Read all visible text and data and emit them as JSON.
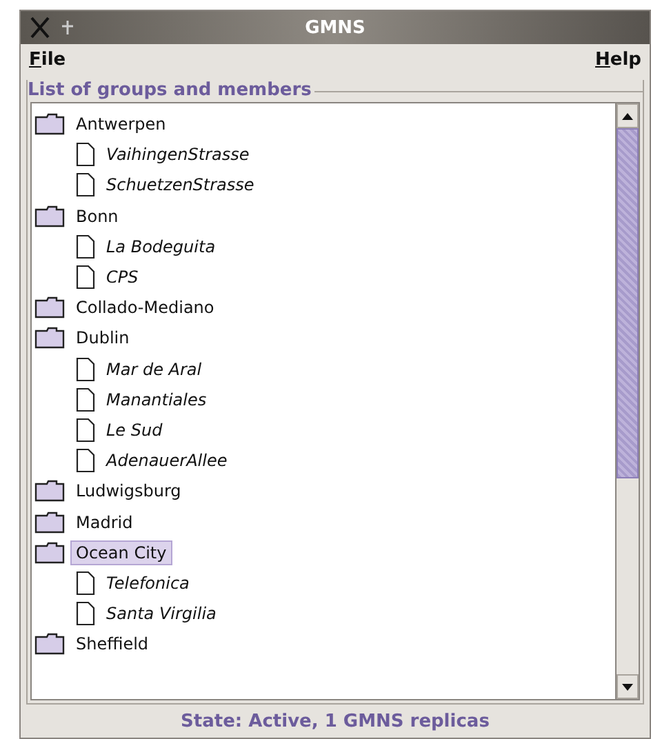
{
  "window": {
    "title": "GMNS"
  },
  "menu": [
    {
      "label": "File"
    },
    {
      "label": "Help"
    }
  ],
  "group_box": {
    "title": "List of groups and members"
  },
  "tree": [
    {
      "label": "Antwerpen",
      "selected": false,
      "children": [
        {
          "label": "VaihingenStrasse"
        },
        {
          "label": "SchuetzenStrasse"
        }
      ]
    },
    {
      "label": "Bonn",
      "selected": false,
      "children": [
        {
          "label": "La Bodeguita"
        },
        {
          "label": "CPS"
        }
      ]
    },
    {
      "label": "Collado-Mediano",
      "selected": false
    },
    {
      "label": "Dublin",
      "selected": false,
      "children": [
        {
          "label": "Mar de Aral"
        },
        {
          "label": "Manantiales"
        },
        {
          "label": "Le Sud"
        },
        {
          "label": "AdenauerAllee"
        }
      ]
    },
    {
      "label": "Ludwigsburg",
      "selected": false
    },
    {
      "label": "Madrid",
      "selected": false
    },
    {
      "label": "Ocean City",
      "selected": true,
      "children": [
        {
          "label": "Telefonica"
        },
        {
          "label": "Santa Virgilia"
        }
      ]
    },
    {
      "label": "Sheffield",
      "selected": false
    }
  ],
  "status_bar": {
    "text": "State: Active, 1 GMNS replicas"
  }
}
